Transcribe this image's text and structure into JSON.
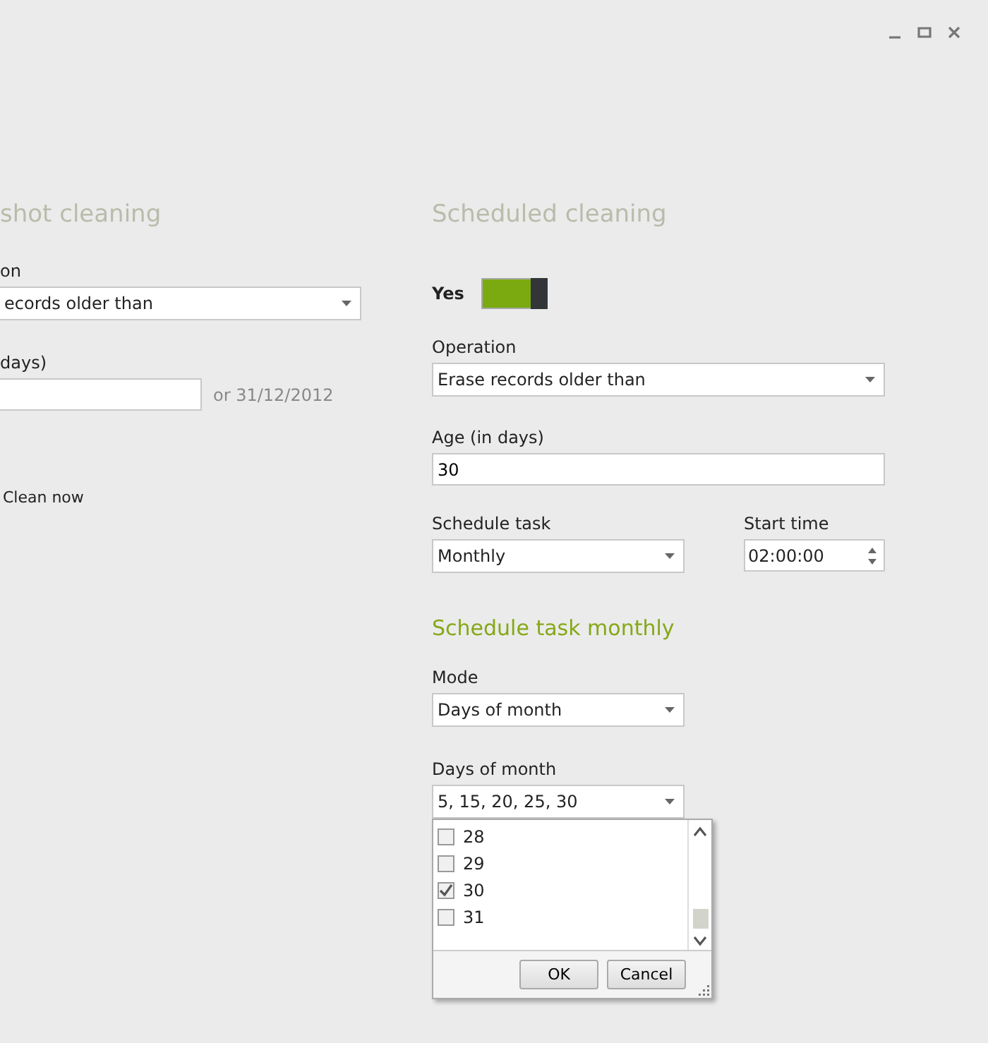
{
  "one_shot": {
    "title": "shot cleaning",
    "operation_label": "on",
    "operation_value": "ecords older than",
    "age_label": "days)",
    "date_hint": "or 31/12/2012",
    "clean_button": "Clean now"
  },
  "scheduled": {
    "title": "Scheduled cleaning",
    "enabled_label": "Yes",
    "enabled": true,
    "operation_label": "Operation",
    "operation_value": "Erase records older than",
    "age_label": "Age (in days)",
    "age_value": "30",
    "schedule_label": "Schedule task",
    "schedule_value": "Monthly",
    "start_label": "Start time",
    "start_value": "02:00:00",
    "monthly": {
      "title": "Schedule task monthly",
      "mode_label": "Mode",
      "mode_value": "Days of month",
      "days_label": "Days of month",
      "days_value": "5, 15, 20, 25, 30",
      "days_list": [
        {
          "label": "28",
          "checked": false
        },
        {
          "label": "29",
          "checked": false
        },
        {
          "label": "30",
          "checked": true
        },
        {
          "label": "31",
          "checked": false
        }
      ],
      "buttons": [
        "OK",
        "Cancel"
      ]
    }
  }
}
